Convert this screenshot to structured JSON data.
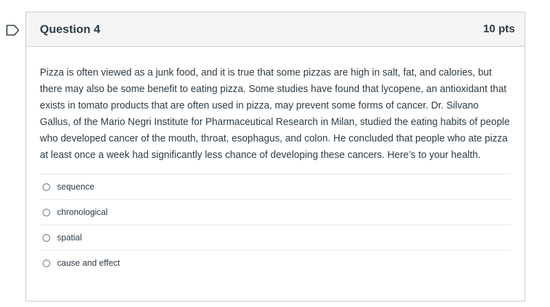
{
  "question": {
    "title": "Question 4",
    "points": "10 pts",
    "text": "Pizza is often viewed as a junk food, and it is true that some pizzas are high in salt, fat, and calories, but there may also be some benefit to eating pizza. Some studies have found that lycopene, an antioxidant that exists in tomato products that are often used in pizza, may prevent some forms of cancer. Dr. Silvano Gallus, of the Mario Negri Institute for Pharmaceutical Research in Milan, studied the eating habits of people who developed cancer of the mouth, throat, esophagus, and colon. He concluded that people who ate pizza at least once a week had significantly less chance of developing these cancers. Here’s to your health.",
    "answers": [
      {
        "label": "sequence"
      },
      {
        "label": "chronological"
      },
      {
        "label": "spatial"
      },
      {
        "label": "cause and effect"
      }
    ]
  },
  "icons": {
    "flag": "flag-question-icon"
  }
}
